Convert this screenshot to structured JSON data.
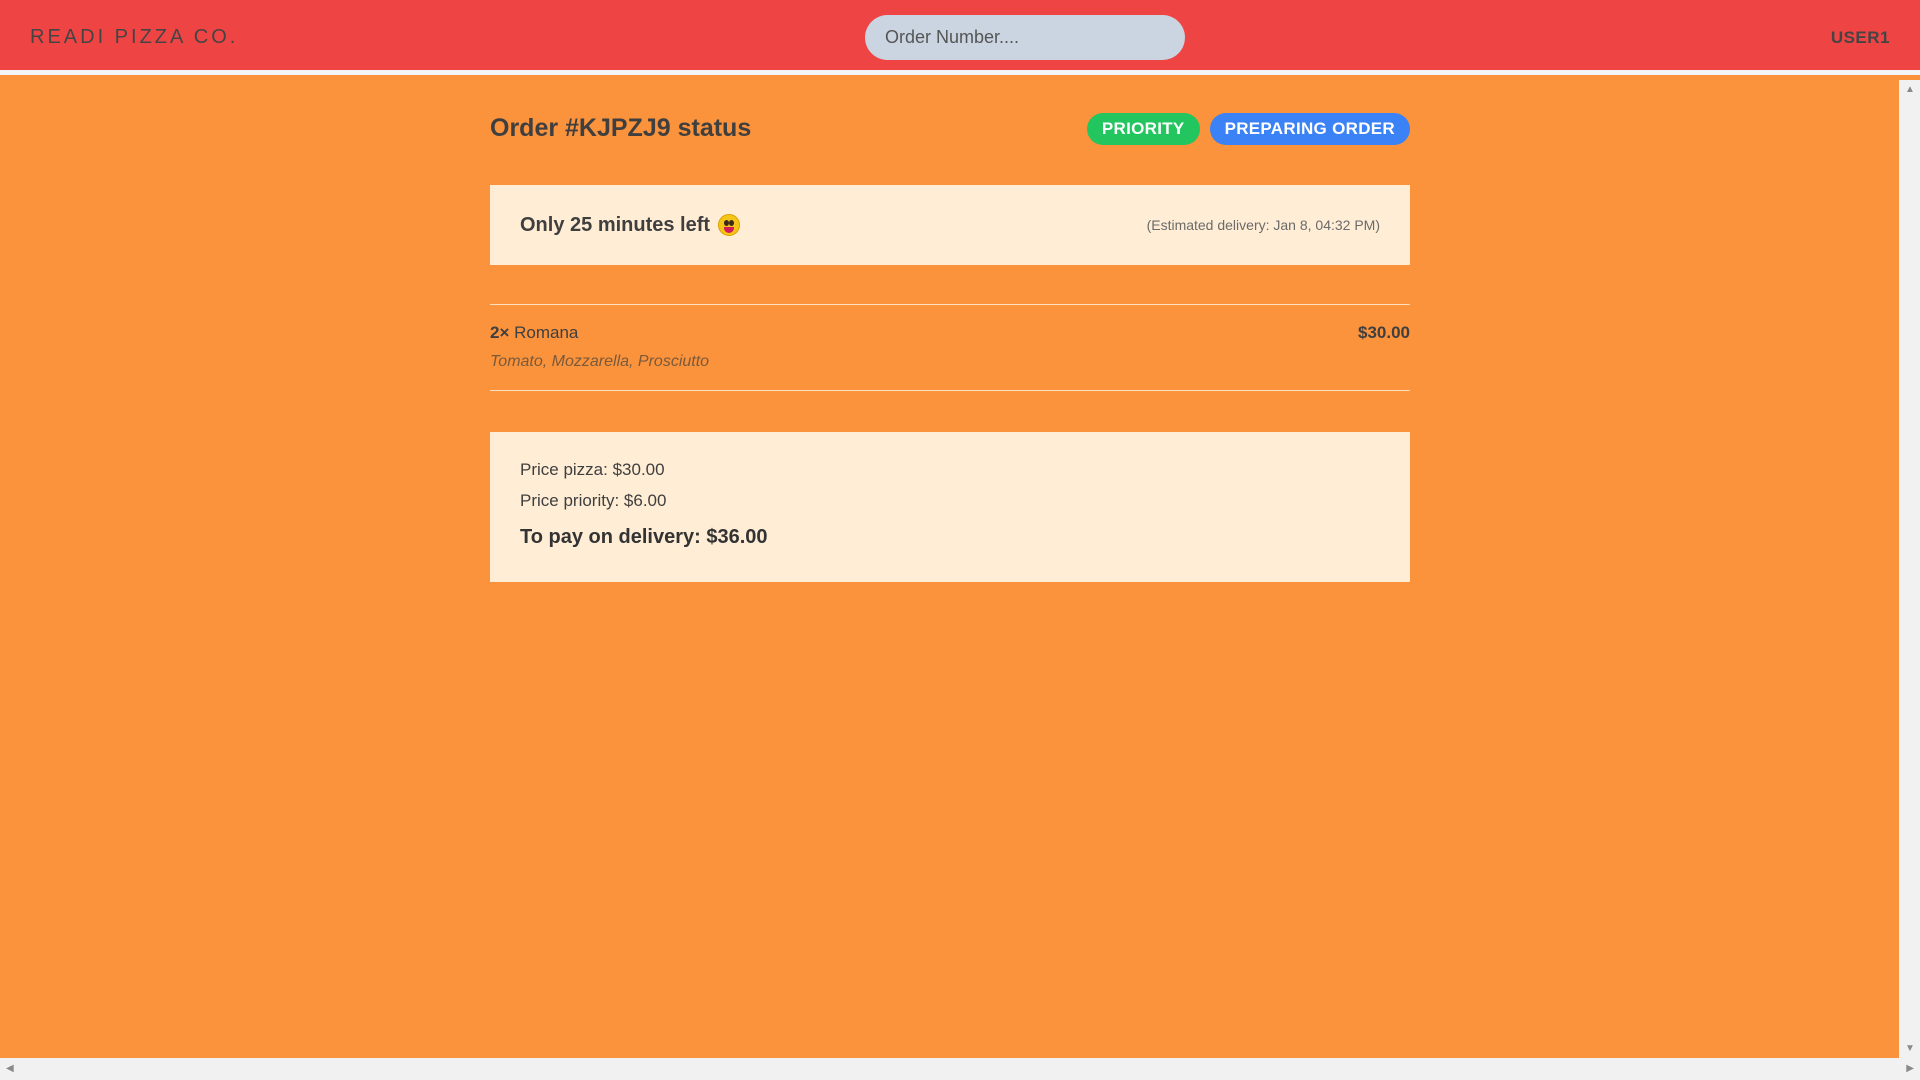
{
  "header": {
    "logo": "READI PIZZA CO.",
    "search_placeholder": "Order Number....",
    "user": "USER1"
  },
  "order": {
    "title": "Order #KJPZJ9 status",
    "badges": {
      "priority": "PRIORITY",
      "status": "PREPARING ORDER"
    },
    "time_left": "Only 25 minutes left",
    "estimated_delivery": "(Estimated delivery: Jan 8, 04:32 PM)",
    "items": [
      {
        "quantity": "2×",
        "name": "Romana",
        "ingredients": "Tomato, Mozzarella, Prosciutto",
        "price": "$30.00"
      }
    ],
    "prices": {
      "pizza": "Price pizza: $30.00",
      "priority": "Price priority: $6.00",
      "total": "To pay on delivery: $36.00"
    }
  },
  "colors": {
    "header_bg": "#ef4444",
    "page_bg": "#fb923c",
    "card_bg": "#ffedd5",
    "priority_badge": "#22c55e",
    "status_badge": "#3b82f6"
  },
  "icons": {
    "time_emoji": "grinning-tongue-emoji-icon"
  }
}
